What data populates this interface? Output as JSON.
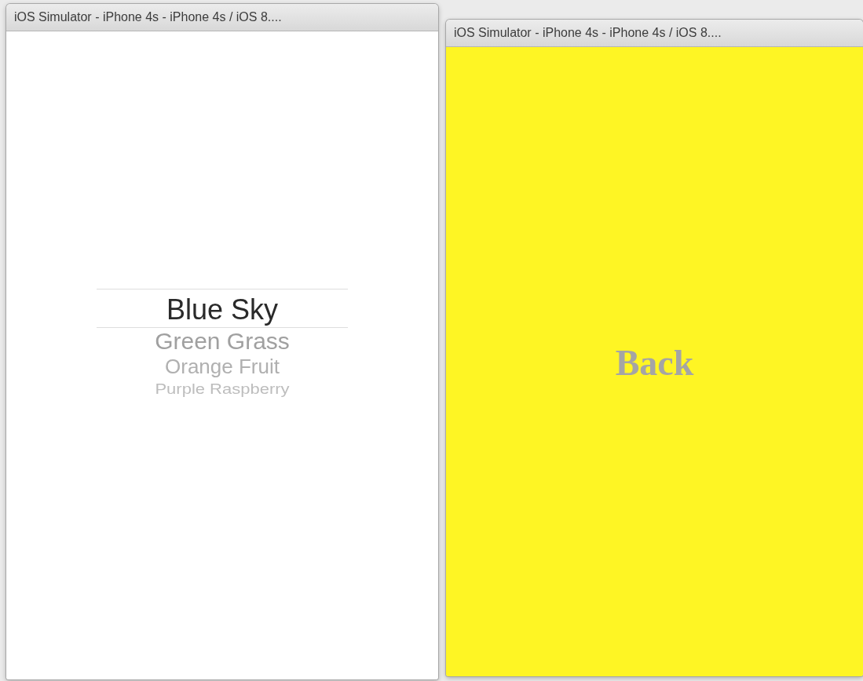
{
  "windows": [
    {
      "title": "iOS Simulator - iPhone 4s - iPhone 4s / iOS 8....",
      "kind": "picker",
      "picker": [
        {
          "label": "Blue Sky",
          "selected": true
        },
        {
          "label": "Green Grass",
          "selected": false
        },
        {
          "label": "Orange Fruit",
          "selected": false
        },
        {
          "label": "Purple Raspberry",
          "selected": false
        }
      ]
    },
    {
      "title": "iOS Simulator - iPhone 4s - iPhone 4s / iOS 8....",
      "kind": "button",
      "button": "Back"
    }
  ]
}
